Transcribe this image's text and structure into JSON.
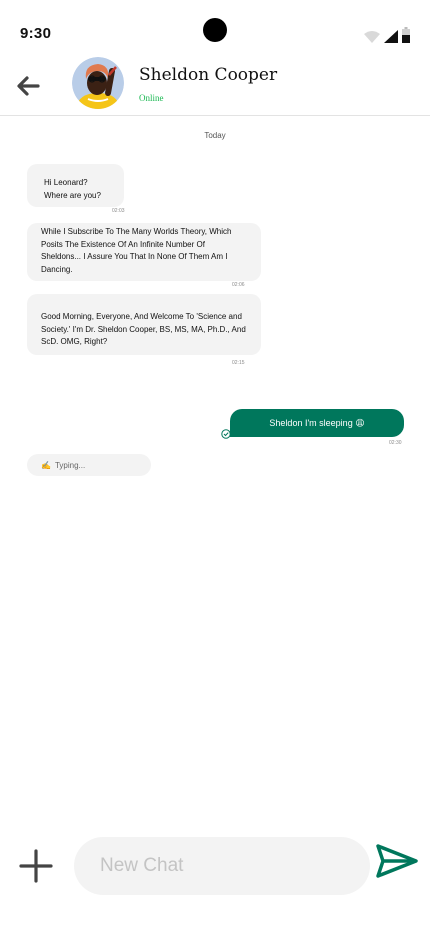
{
  "status_bar": {
    "time": "9:30"
  },
  "header": {
    "contact_name": "Sheldon Cooper",
    "contact_status": "Online"
  },
  "chat": {
    "date_separator": "Today",
    "messages_in": [
      {
        "lines": [
          "Hi Leonard?",
          "Where are you?"
        ],
        "time": "02:03"
      },
      {
        "lines": [
          "While I Subscribe To The Many Worlds Theory, Which",
          "Posits The Existence Of An Infinite Number Of",
          "Sheldons... I Assure You That In None Of Them Am I",
          "Dancing."
        ],
        "time": "02:06"
      },
      {
        "lines": [
          "Good Morning, Everyone, And Welcome To 'Science and",
          "Society.' I'm Dr. Sheldon Cooper, BS, MS, MA, Ph.D., And",
          "ScD. OMG, Right?"
        ],
        "time": "02:15"
      }
    ],
    "message_out": {
      "text": "Sheldon I'm sleeping 😩",
      "time": "02:30"
    },
    "typing": {
      "emoji": "✍️",
      "text": "Typing..."
    }
  },
  "composer": {
    "placeholder": "New Chat"
  },
  "colors": {
    "accent": "#00775c",
    "online": "#1db954",
    "bubble_bg": "#f3f3f3"
  },
  "icons": [
    "back-arrow-icon",
    "check-circle-icon",
    "plus-icon",
    "send-icon",
    "wifi-icon",
    "signal-icon",
    "battery-icon"
  ]
}
